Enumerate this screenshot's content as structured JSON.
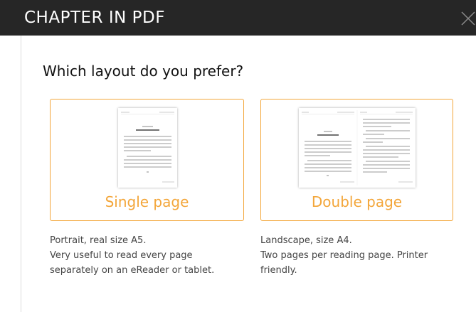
{
  "header": {
    "title": "CHAPTER IN PDF",
    "close_icon": "close-icon"
  },
  "question": "Which layout do you prefer?",
  "accent_color": "#f3a63a",
  "options": [
    {
      "label": "Single page",
      "description_lines": [
        "Portrait, real size A5.",
        "Very useful to read every page",
        "separately on an eReader or tablet."
      ]
    },
    {
      "label": "Double page",
      "description_lines": [
        "Landscape, size A4.",
        "Two pages per reading page. Printer",
        "friendly."
      ]
    }
  ]
}
